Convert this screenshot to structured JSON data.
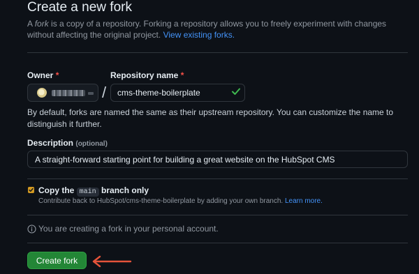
{
  "page": {
    "title": "Create a new fork",
    "intro_prefix": "A ",
    "intro_em": "fork",
    "intro_rest": " is a copy of a repository. Forking a repository allows you to freely experiment with changes without affecting the original project. ",
    "intro_link": "View existing forks."
  },
  "owner": {
    "label": "Owner",
    "required_mark": "*"
  },
  "repo": {
    "label": "Repository name",
    "required_mark": "*",
    "value": "cms-theme-boilerplate",
    "separator": "/"
  },
  "helper_text": "By default, forks are named the same as their upstream repository. You can customize the name to distinguish it further.",
  "description": {
    "label": "Description",
    "optional": "(optional)",
    "value": "A straight-forward starting point for building a great website on the HubSpot CMS"
  },
  "copy_branch": {
    "checked": true,
    "label_prefix": "Copy the ",
    "branch": "main",
    "label_suffix": " branch only",
    "help": "Contribute back to HubSpot/cms-theme-boilerplate by adding your own branch. ",
    "help_link": "Learn more."
  },
  "notice": {
    "icon": "info-icon",
    "text": "You are creating a fork in your personal account."
  },
  "submit": {
    "label": "Create fork"
  },
  "colors": {
    "accent_green": "#238636",
    "link_blue": "#4493f8",
    "arrow_red": "#e5533a"
  }
}
